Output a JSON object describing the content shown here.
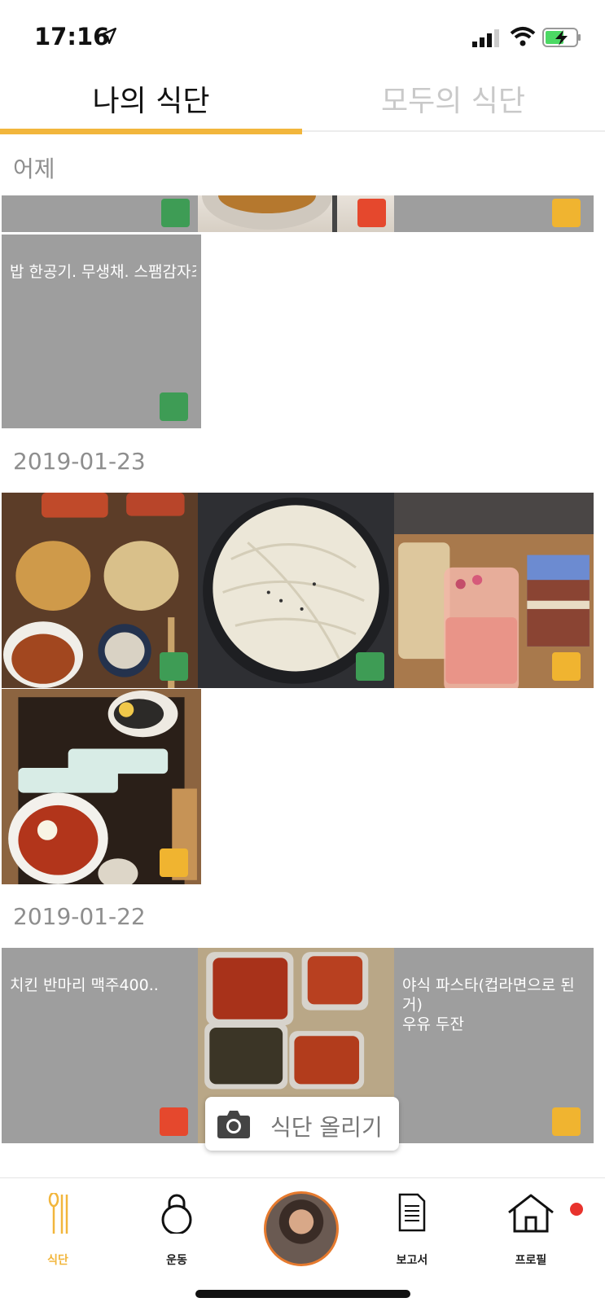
{
  "status_bar": {
    "time": "17:16"
  },
  "tabs": [
    {
      "label": "나의 식단",
      "active": true
    },
    {
      "label": "모두의 식단",
      "active": false
    }
  ],
  "sections": [
    {
      "date": "어제",
      "tiles": [
        {
          "kind": "gray",
          "text": "",
          "badge": "green"
        },
        {
          "kind": "photo",
          "text": "",
          "badge": "red"
        },
        {
          "kind": "gray",
          "text": "",
          "badge": "yellow"
        },
        {
          "kind": "gray",
          "text": "밥 한공기. 무생채. 스팸감자조",
          "badge": "green"
        }
      ]
    },
    {
      "date": "2019-01-23",
      "tiles": [
        {
          "kind": "photo",
          "text": "",
          "badge": "green"
        },
        {
          "kind": "photo",
          "text": "",
          "badge": "green"
        },
        {
          "kind": "photo",
          "text": "",
          "badge": "yellow"
        },
        {
          "kind": "photo",
          "text": "",
          "badge": "yellow"
        }
      ]
    },
    {
      "date": "2019-01-22",
      "tiles": [
        {
          "kind": "gray",
          "text": "치킨 반마리 맥주400..",
          "badge": "red"
        },
        {
          "kind": "photo",
          "text": "",
          "badge": "green"
        },
        {
          "kind": "gray",
          "text": "야식 파스타(컵라면으로 된거)\n우유 두잔",
          "badge": "yellow"
        }
      ]
    }
  ],
  "upload_button": {
    "label": "식단 올리기",
    "icon": "camera-icon"
  },
  "bottom_nav": [
    {
      "label": "식단",
      "icon": "spoon-chopsticks-icon",
      "active": true
    },
    {
      "label": "운동",
      "icon": "lock-icon",
      "active": false
    },
    {
      "label": "",
      "icon": "profile-avatar",
      "active": false
    },
    {
      "label": "보고서",
      "icon": "document-icon",
      "active": false
    },
    {
      "label": "프로필",
      "icon": "house-icon",
      "active": false,
      "has_notification": true
    }
  ],
  "colors": {
    "accent": "#f2b63c",
    "badge_green": "#3e9c55",
    "badge_red": "#e5482d",
    "badge_yellow": "#f0b430",
    "placeholder_gray": "#9e9e9e"
  }
}
